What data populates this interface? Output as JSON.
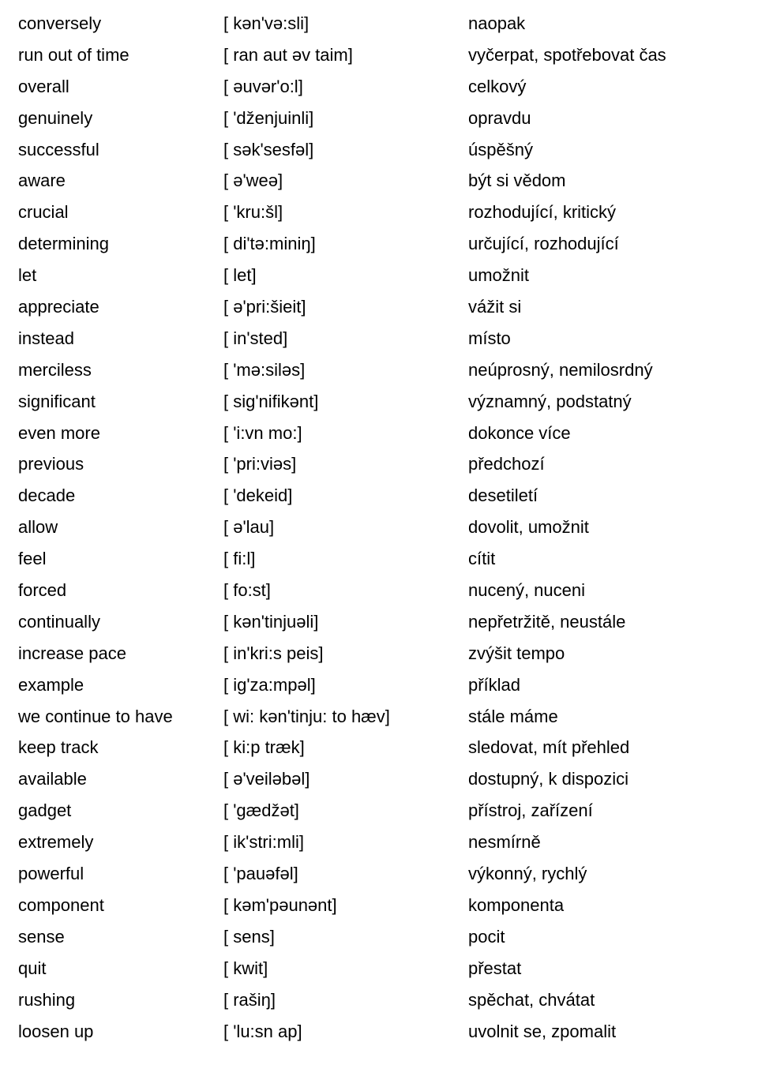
{
  "entries": [
    {
      "word": "conversely",
      "phonetic": "[ kən'və:sli]",
      "translation": "naopak"
    },
    {
      "word": "run out of time",
      "phonetic": "[ ran aut əv taim]",
      "translation": "vyčerpat, spotřebovat čas"
    },
    {
      "word": "overall",
      "phonetic": "[ əuvər'o:l]",
      "translation": "celkový"
    },
    {
      "word": "genuinely",
      "phonetic": "[ 'dženjuinli]",
      "translation": "opravdu"
    },
    {
      "word": "successful",
      "phonetic": "[ sək'sesfəl]",
      "translation": "úspěšný"
    },
    {
      "word": "aware",
      "phonetic": "[ ə'weə]",
      "translation": "být si vědom"
    },
    {
      "word": "crucial",
      "phonetic": "[ 'kru:šl]",
      "translation": "rozhodující, kritický"
    },
    {
      "word": "determining",
      "phonetic": "[ di'tə:miniŋ]",
      "translation": "určující, rozhodující"
    },
    {
      "word": "let",
      "phonetic": "[ let]",
      "translation": "umožnit"
    },
    {
      "word": "appreciate",
      "phonetic": "[ ə'pri:šieit]",
      "translation": "vážit si"
    },
    {
      "word": "instead",
      "phonetic": "[ in'sted]",
      "translation": "místo"
    },
    {
      "word": "merciless",
      "phonetic": "[ 'mə:siləs]",
      "translation": "neúprosný, nemilosrdný"
    },
    {
      "word": "significant",
      "phonetic": "[ sig'nifikənt]",
      "translation": "významný, podstatný"
    },
    {
      "word": "even more",
      "phonetic": "[ 'i:vn mo:]",
      "translation": "dokonce více"
    },
    {
      "word": "previous",
      "phonetic": "[ 'pri:viəs]",
      "translation": "předchozí"
    },
    {
      "word": "decade",
      "phonetic": "[ 'dekeid]",
      "translation": "desetiletí"
    },
    {
      "word": "allow",
      "phonetic": "[ ə'lau]",
      "translation": "dovolit, umožnit"
    },
    {
      "word": "feel",
      "phonetic": "[ fi:l]",
      "translation": "cítit"
    },
    {
      "word": "forced",
      "phonetic": "[ fo:st]",
      "translation": "nucený, nuceni"
    },
    {
      "word": "continually",
      "phonetic": "[ kən'tinjuəli]",
      "translation": "nepřetržitě, neustále"
    },
    {
      "word": "increase pace",
      "phonetic": "[ in'kri:s peis]",
      "translation": "zvýšit tempo"
    },
    {
      "word": "example",
      "phonetic": "[ ig'za:mpəl]",
      "translation": "příklad"
    },
    {
      "word": "we continue to have",
      "phonetic": "[ wi: kən'tinju: to hæv]",
      "translation": "stále máme"
    },
    {
      "word": "keep track",
      "phonetic": "[ ki:p træk]",
      "translation": "sledovat, mít přehled"
    },
    {
      "word": "available",
      "phonetic": "[ ə'veiləbəl]",
      "translation": "dostupný, k dispozici"
    },
    {
      "word": "gadget",
      "phonetic": "[ 'gædžət]",
      "translation": "přístroj, zařízení"
    },
    {
      "word": "extremely",
      "phonetic": "[ ik'stri:mli]",
      "translation": "nesmírně"
    },
    {
      "word": "powerful",
      "phonetic": "[ 'pauəfəl]",
      "translation": "výkonný, rychlý"
    },
    {
      "word": "component",
      "phonetic": "[ kəm'pəunənt]",
      "translation": "komponenta"
    },
    {
      "word": "sense",
      "phonetic": "[ sens]",
      "translation": "pocit"
    },
    {
      "word": "quit",
      "phonetic": "[ kwit]",
      "translation": "přestat"
    },
    {
      "word": "rushing",
      "phonetic": "[ rašiŋ]",
      "translation": "spěchat, chvátat"
    },
    {
      "word": "loosen up",
      "phonetic": "[ 'lu:sn ap]",
      "translation": "uvolnit se, zpomalit"
    }
  ]
}
